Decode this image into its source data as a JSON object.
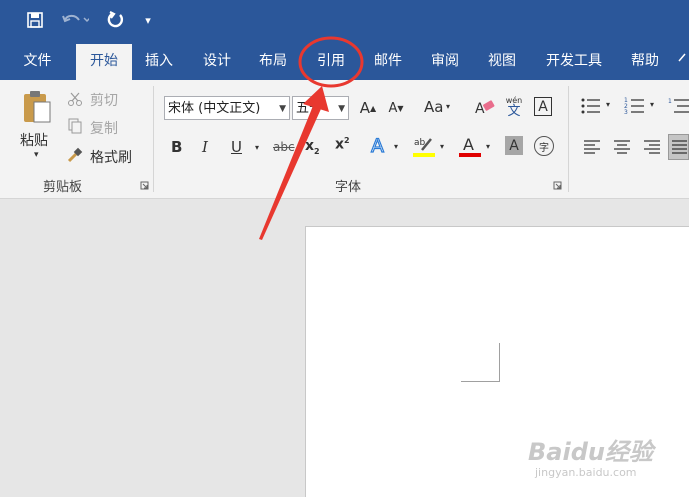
{
  "quick_access": {
    "save": "save-icon",
    "undo": "undo-icon",
    "redo": "redo-icon",
    "customize": "▾"
  },
  "tabs": [
    {
      "label": "文件"
    },
    {
      "label": "开始"
    },
    {
      "label": "插入"
    },
    {
      "label": "设计"
    },
    {
      "label": "布局"
    },
    {
      "label": "引用"
    },
    {
      "label": "邮件"
    },
    {
      "label": "审阅"
    },
    {
      "label": "视图"
    },
    {
      "label": "开发工具"
    },
    {
      "label": "帮助"
    }
  ],
  "clipboard": {
    "paste": "粘贴",
    "cut": "剪切",
    "copy": "复制",
    "format_painter": "格式刷",
    "group_label": "剪贴板"
  },
  "font": {
    "font_name": "宋体 (中文正文)",
    "font_size": "五号",
    "phonetic_top": "wén",
    "phonetic_bottom": "文",
    "border_char": "A",
    "change_case": "Aa",
    "group_label": "字体"
  },
  "colors": {
    "title_bar": "#2b579a",
    "ribbon": "#f3f3f3",
    "highlight": "#ffff00",
    "font_color": "#e00000",
    "annotation": "#e8382f"
  },
  "watermark": {
    "brand": "Baidu经验",
    "url": "jingyan.baidu.com"
  }
}
